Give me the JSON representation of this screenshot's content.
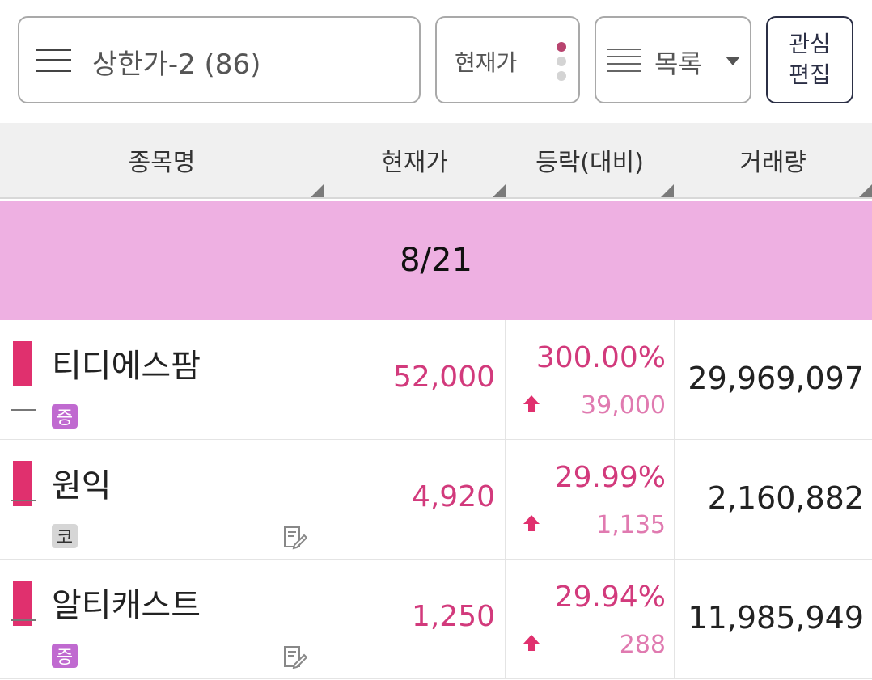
{
  "toolbar": {
    "search_text": "상한가-2 (86)",
    "price_button_label": "현재가",
    "list_button_label": "목록",
    "fav_edit_line1": "관심",
    "fav_edit_line2": "편집"
  },
  "table": {
    "columns": [
      "종목명",
      "현재가",
      "등락(대비)",
      "거래량"
    ],
    "date_label": "8/21",
    "rows": [
      {
        "name": "티디에스팜",
        "market": "증",
        "price": "52,000",
        "change_pct": "300.00%",
        "change_abs": "39,000",
        "volume": "29,969,097",
        "has_memo": false
      },
      {
        "name": "원익",
        "market": "코",
        "price": "4,920",
        "change_pct": "29.99%",
        "change_abs": "1,135",
        "volume": "2,160,882",
        "has_memo": true
      },
      {
        "name": "알티캐스트",
        "market": "증",
        "price": "1,250",
        "change_pct": "29.94%",
        "change_abs": "288",
        "volume": "11,985,949",
        "has_memo": true
      }
    ]
  },
  "colors": {
    "up": "#d23a7c",
    "date_banner": "#eeb0e2",
    "marker": "#e0306e"
  },
  "icons": [
    "hamburger-menu-icon",
    "list-icon",
    "dropdown-caret-icon",
    "up-arrow-icon",
    "memo-edit-icon"
  ]
}
